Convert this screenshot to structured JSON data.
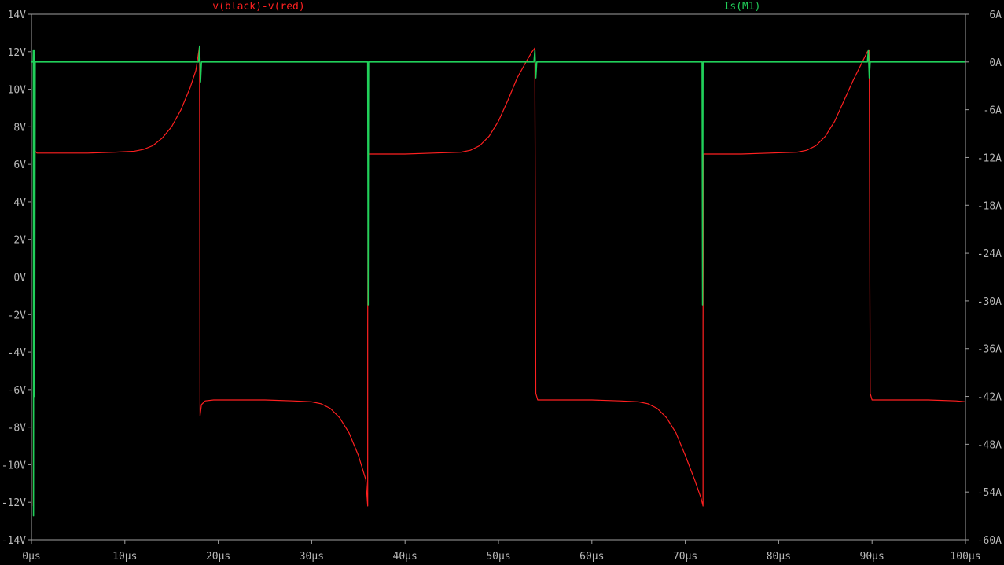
{
  "chart_data": {
    "type": "line",
    "title": "",
    "grid": false,
    "background": "#000000",
    "axis_color": "#a0a0a0",
    "x_axis": {
      "label": "",
      "unit": "µs",
      "range": [
        0,
        100
      ],
      "ticks": [
        "0µs",
        "10µs",
        "20µs",
        "30µs",
        "40µs",
        "50µs",
        "60µs",
        "70µs",
        "80µs",
        "90µs",
        "100µs"
      ]
    },
    "y_left": {
      "label": "",
      "unit": "V",
      "range": [
        -14,
        14
      ],
      "ticks": [
        "14V",
        "12V",
        "10V",
        "8V",
        "6V",
        "4V",
        "2V",
        "0V",
        "-2V",
        "-4V",
        "-6V",
        "-8V",
        "-10V",
        "-12V",
        "-14V"
      ]
    },
    "y_right": {
      "label": "",
      "unit": "A",
      "range": [
        -60,
        6
      ],
      "ticks": [
        "6A",
        "0A",
        "-6A",
        "-12A",
        "-18A",
        "-24A",
        "-30A",
        "-36A",
        "-42A",
        "-48A",
        "-54A",
        "-60A"
      ]
    },
    "series": [
      {
        "name": "v(black)-v(red)",
        "color": "#ff2020",
        "axis": "left",
        "x": [
          0.2,
          0.25,
          0.3,
          0.4,
          0.6,
          1,
          3,
          6,
          9,
          11,
          12,
          13,
          14,
          15,
          16,
          17,
          17.6,
          18.0,
          18.0,
          18.05,
          18.2,
          18.6,
          19.5,
          22,
          25,
          28,
          30,
          31,
          32,
          33,
          34,
          35,
          35.8,
          36.0,
          36.0,
          36.05,
          37,
          40,
          43,
          46,
          47,
          48,
          49,
          50,
          51,
          52,
          53,
          53.6,
          53.9,
          53.9,
          54.0,
          54.2,
          57,
          60,
          63,
          65,
          66,
          67,
          68,
          69,
          70,
          71,
          71.7,
          71.9,
          71.9,
          71.95,
          73,
          76,
          79,
          82,
          83,
          84,
          85,
          86,
          87,
          88,
          89,
          89.5,
          89.7,
          89.7,
          89.8,
          90,
          93,
          96,
          99,
          100
        ],
        "y": [
          -12.2,
          7.5,
          6.9,
          6.7,
          6.6,
          6.6,
          6.6,
          6.6,
          6.65,
          6.7,
          6.8,
          7.0,
          7.4,
          8.0,
          8.9,
          10.1,
          11.0,
          12.3,
          10.5,
          -7.4,
          -6.8,
          -6.6,
          -6.55,
          -6.55,
          -6.55,
          -6.6,
          -6.65,
          -6.75,
          -7.0,
          -7.5,
          -8.3,
          -9.5,
          -10.8,
          -12.2,
          -2.5,
          6.55,
          6.55,
          6.55,
          6.6,
          6.65,
          6.75,
          7.0,
          7.5,
          8.3,
          9.4,
          10.6,
          11.5,
          12.0,
          12.2,
          10.6,
          -6.2,
          -6.55,
          -6.55,
          -6.55,
          -6.6,
          -6.65,
          -6.75,
          -7.0,
          -7.5,
          -8.3,
          -9.5,
          -10.8,
          -11.8,
          -12.2,
          -2.5,
          6.55,
          6.55,
          6.55,
          6.6,
          6.65,
          6.75,
          7.0,
          7.5,
          8.3,
          9.4,
          10.5,
          11.5,
          12.0,
          12.1,
          10.6,
          -6.2,
          -6.55,
          -6.55,
          -6.55,
          -6.6,
          -6.65
        ]
      },
      {
        "name": "Is(M1)",
        "color": "#21d05a",
        "axis": "right",
        "x": [
          0,
          0.18,
          0.2,
          0.22,
          0.24,
          0.3,
          0.32,
          0.34,
          0.4,
          17.9,
          18.0,
          18.1,
          18.2,
          35.9,
          36.0,
          36.05,
          36.1,
          53.8,
          53.9,
          54.0,
          54.1,
          71.7,
          71.8,
          71.85,
          71.9,
          89.5,
          89.6,
          89.7,
          89.8,
          100
        ],
        "y": [
          0,
          0,
          1.5,
          -57,
          -5,
          0,
          1.5,
          -42,
          0,
          0,
          2,
          -2.5,
          0,
          0,
          0,
          -30.5,
          0,
          0,
          1.5,
          -2,
          0,
          0,
          0,
          -30.5,
          0,
          0,
          1.5,
          -2,
          0,
          0
        ]
      }
    ]
  }
}
